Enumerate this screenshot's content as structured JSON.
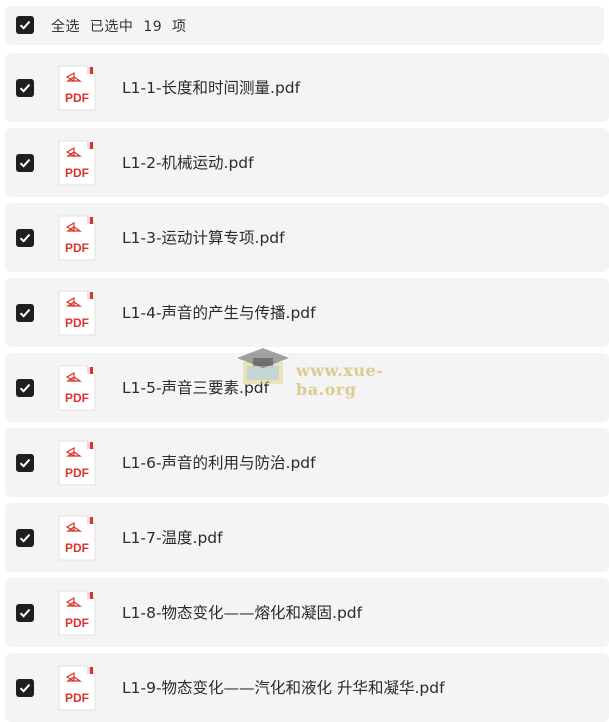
{
  "header": {
    "select_all_label": "全选",
    "selected_text": "已选中",
    "count": "19",
    "unit": "项"
  },
  "files": [
    {
      "name": "L1-1-长度和时间测量.pdf",
      "checked": true
    },
    {
      "name": "L1-2-机械运动.pdf",
      "checked": true
    },
    {
      "name": "L1-3-运动计算专项.pdf",
      "checked": true
    },
    {
      "name": "L1-4-声音的产生与传播.pdf",
      "checked": true
    },
    {
      "name": "L1-5-声音三要素.pdf",
      "checked": true
    },
    {
      "name": "L1-6-声音的利用与防治.pdf",
      "checked": true
    },
    {
      "name": "L1-7-温度.pdf",
      "checked": true
    },
    {
      "name": "L1-8-物态变化——熔化和凝固.pdf",
      "checked": true
    },
    {
      "name": "L1-9-物态变化——汽化和液化 升华和凝华.pdf",
      "checked": true
    }
  ],
  "icon_label": "PDF",
  "watermark": "www.xue-ba.org",
  "colors": {
    "pdf_red": "#d9342b",
    "checkbox": "#1f1f1f",
    "row_bg": "#f4f4f4"
  }
}
